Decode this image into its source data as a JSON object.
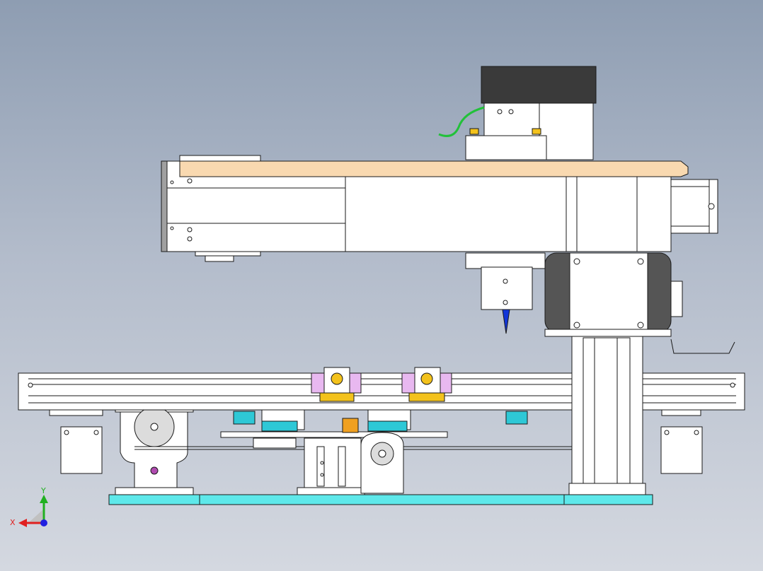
{
  "scene": {
    "background_top": "#8e9db2",
    "background_bottom": "#d4d8e0",
    "line_color": "#1a1a1a",
    "part_fill": "#ffffff",
    "wood_fill": "#f9d9b0",
    "base_fill": "#5ee8ea",
    "motor_dark": "#555555",
    "cover_dark": "#3a3a3a",
    "cable_color": "#22c13a",
    "bolt_yellow": "#f3c21c",
    "gear_orange": "#f0a020",
    "tool_blue": "#1236d8",
    "bracket_purple": "#e8b8f0"
  },
  "triad": {
    "x_label": "X",
    "y_label": "Y",
    "x_color": "#e02020",
    "y_color": "#20b020",
    "z_color": "#2020e0"
  }
}
